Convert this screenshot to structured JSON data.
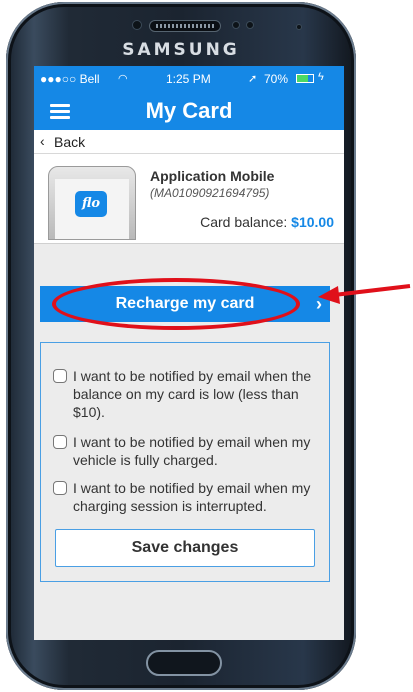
{
  "device": {
    "brand": "SAMSUNG"
  },
  "status_bar": {
    "carrier": "●●●○○ Bell",
    "time": "1:25 PM",
    "battery": "70%"
  },
  "nav": {
    "title": "My Card"
  },
  "back": {
    "label": "Back"
  },
  "card": {
    "name": "Application Mobile",
    "id": "(MA01090921694795)",
    "balance_label": "Card balance:",
    "balance_value": "$10.00",
    "logo_text": "flo"
  },
  "recharge": {
    "label": "Recharge my card"
  },
  "options": [
    {
      "label": "I want to be notified by email when the balance on my card is low (less than $10).",
      "checked": false
    },
    {
      "label": "I want to be notified by email when my vehicle is fully charged.",
      "checked": false
    },
    {
      "label": "I want to be notified by email when my charging session is interrupted.",
      "checked": false
    }
  ],
  "save": {
    "label": "Save changes"
  },
  "colors": {
    "accent": "#1588e6",
    "annotation": "#e0101a"
  }
}
